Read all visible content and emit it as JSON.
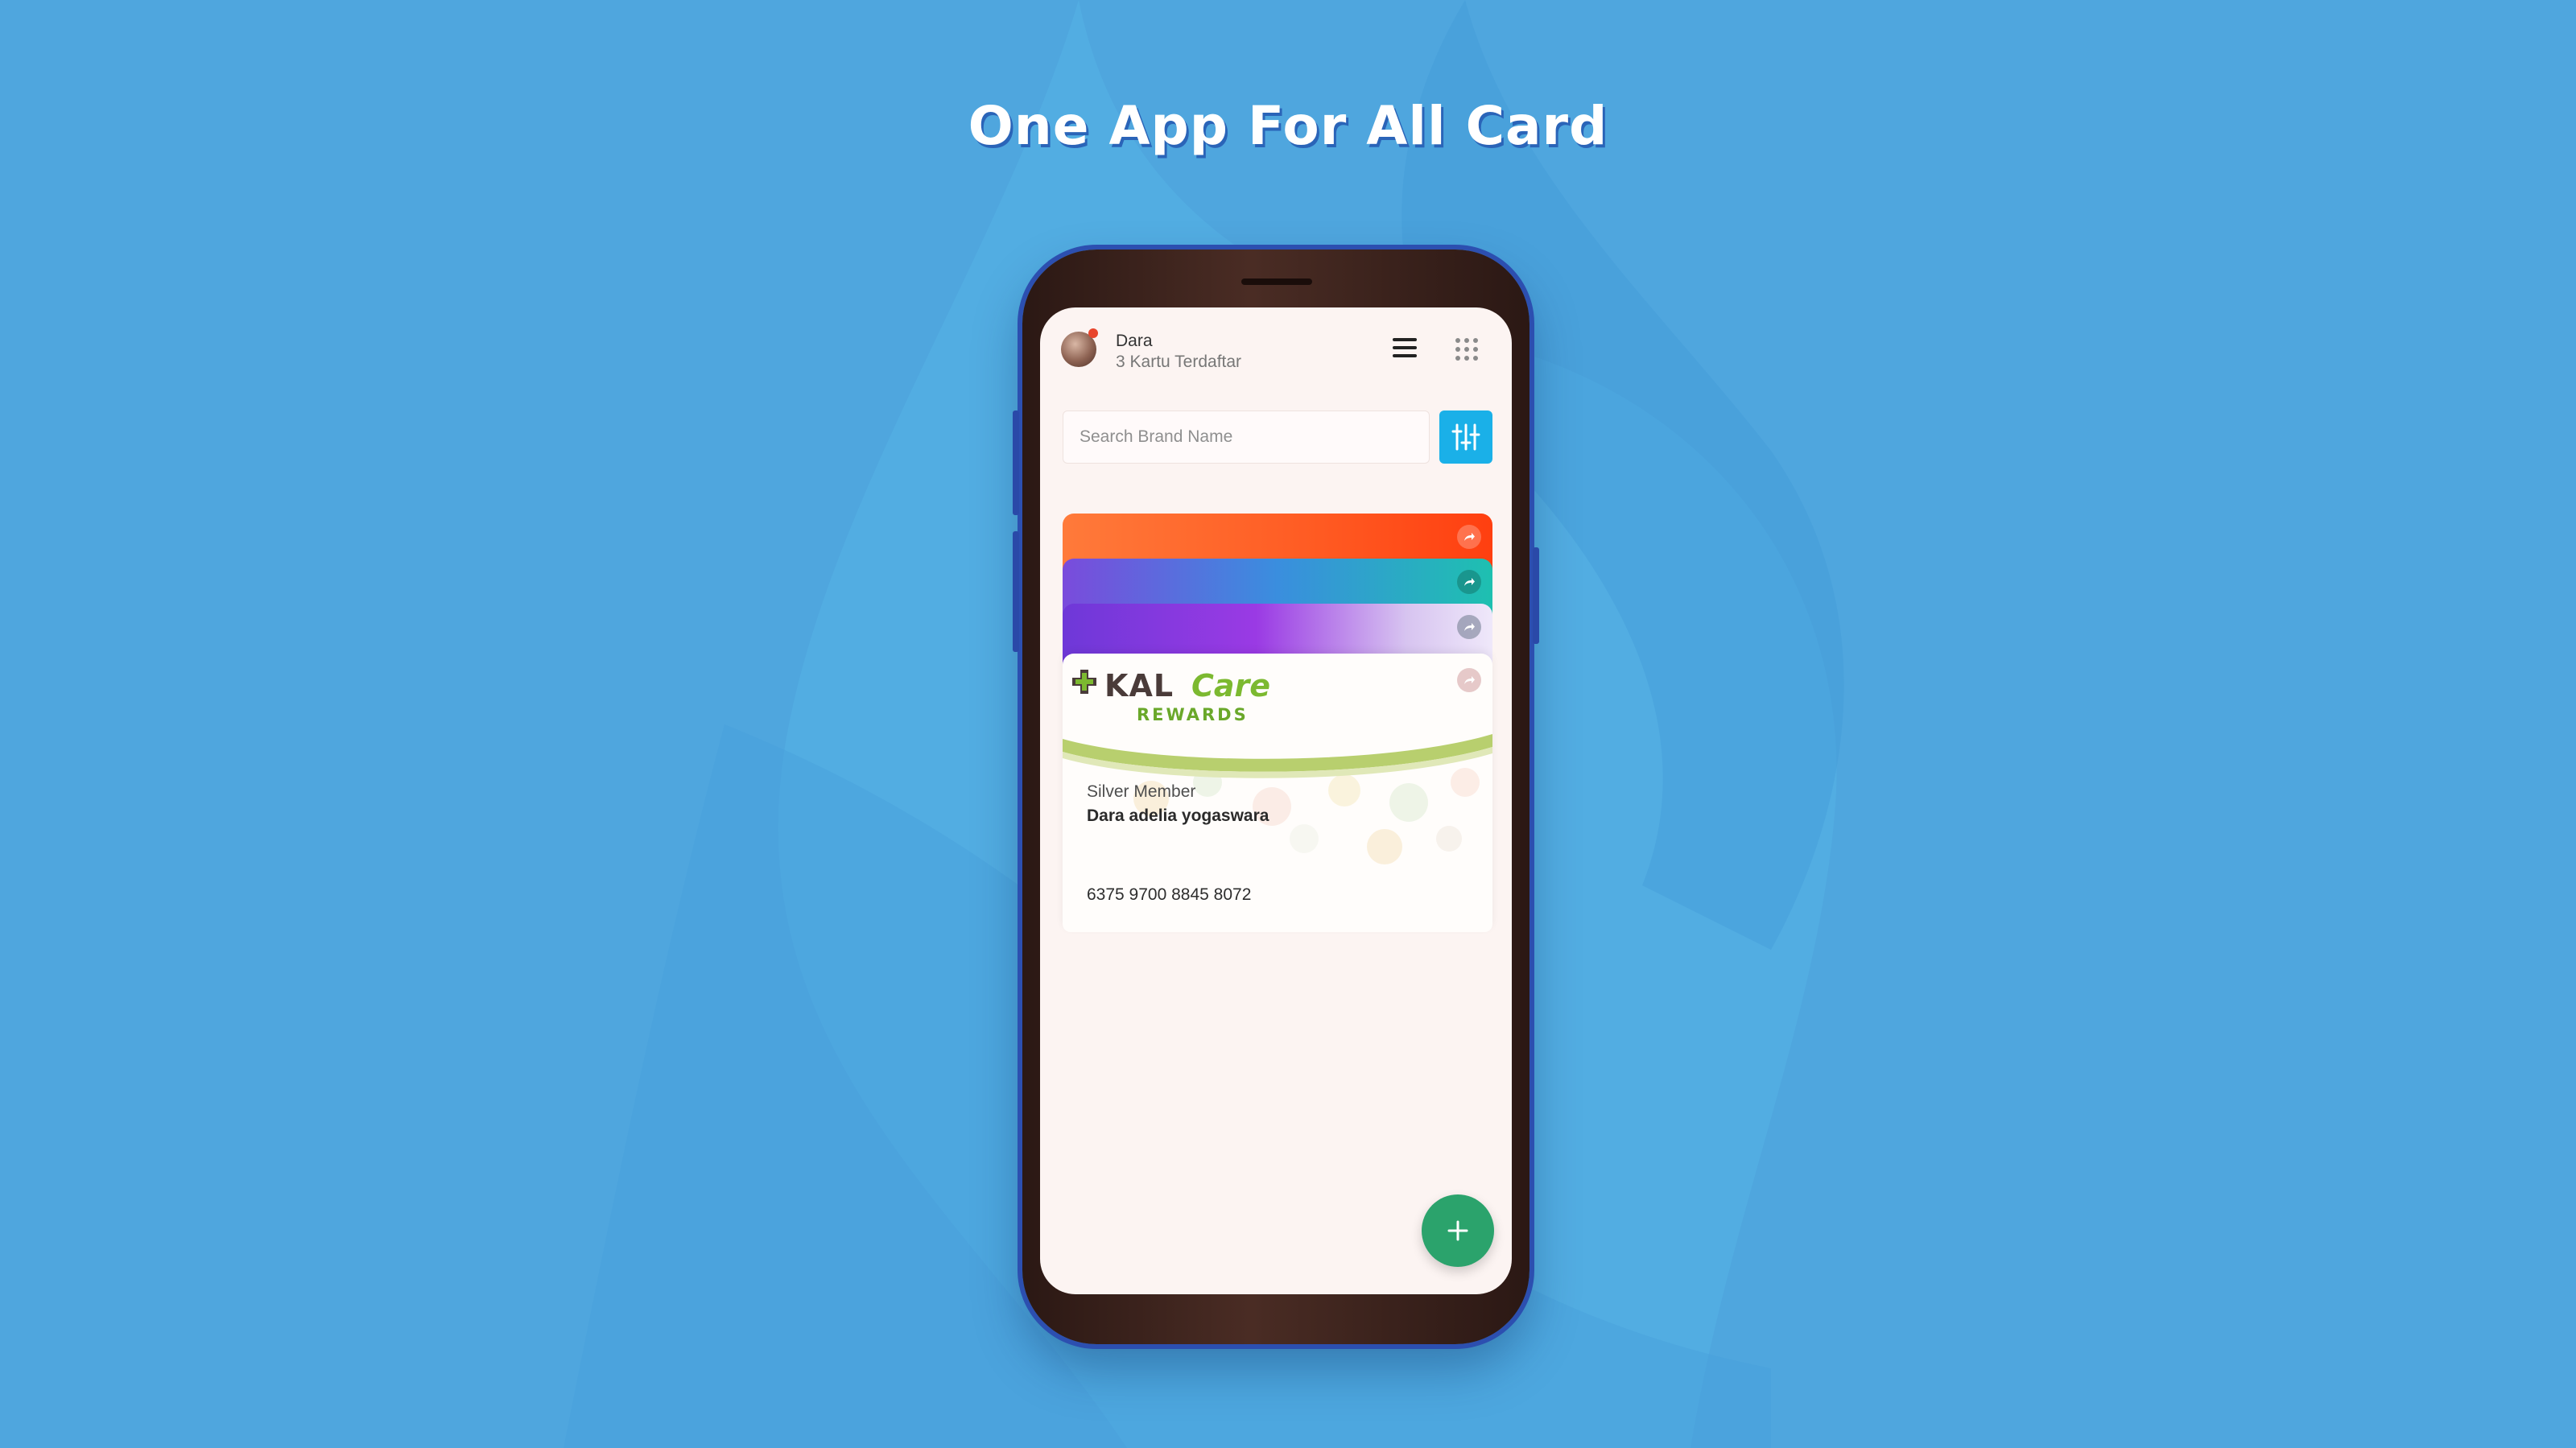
{
  "promo": {
    "headline": "One App For All Card"
  },
  "header": {
    "user_name": "Dara",
    "card_count_label": "3 Kartu Terdaftar",
    "menu_icon": "hamburger-icon",
    "apps_icon": "apps-grid-icon"
  },
  "search": {
    "placeholder": "Search Brand Name",
    "value": "",
    "filter_icon": "filter-sliders-icon"
  },
  "cards": [
    {
      "color": "#ff5a22",
      "share_icon": "share-icon"
    },
    {
      "color": "#1ec0b0",
      "share_icon": "share-icon"
    },
    {
      "color": "#9a3ae4",
      "share_icon": "share-icon"
    }
  ],
  "active_card": {
    "brand_kal": "KAL",
    "brand_care": "Care",
    "brand_rewards": "REWARDS",
    "member_level": "Silver Member",
    "member_name": "Dara adelia yogaswara",
    "card_number": "6375 9700 8845 8072",
    "share_icon": "share-icon"
  },
  "fab": {
    "icon": "plus-icon",
    "color": "#2ba36c"
  },
  "colors": {
    "background": "#4fa6de",
    "accent": "#1ab0e8",
    "headline_shadow": "#2a64b8"
  }
}
